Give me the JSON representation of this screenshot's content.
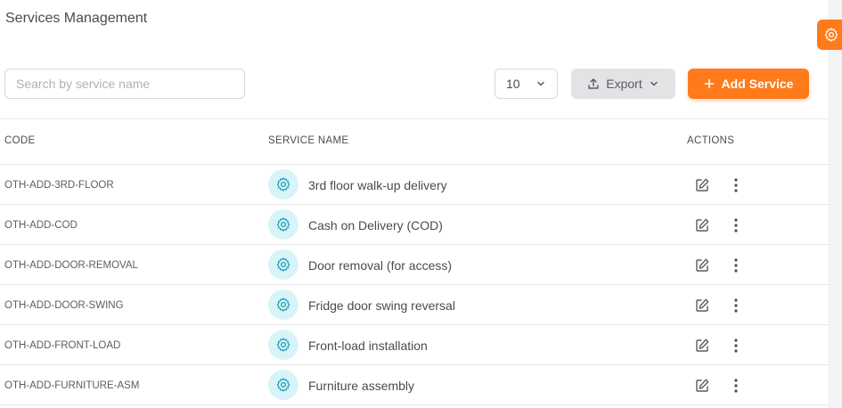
{
  "page": {
    "title": "Services Management"
  },
  "toolbar": {
    "search_placeholder": "Search by service name",
    "search_value": "",
    "page_size": "10",
    "export_label": "Export",
    "add_label": "Add Service"
  },
  "table": {
    "headers": {
      "code": "CODE",
      "service_name": "SERVICE NAME",
      "actions": "ACTIONS"
    },
    "rows": [
      {
        "code": "OTH-ADD-3RD-FLOOR",
        "name": "3rd floor walk-up delivery"
      },
      {
        "code": "OTH-ADD-COD",
        "name": "Cash on Delivery (COD)"
      },
      {
        "code": "OTH-ADD-DOOR-REMOVAL",
        "name": "Door removal (for access)"
      },
      {
        "code": "OTH-ADD-DOOR-SWING",
        "name": "Fridge door swing reversal"
      },
      {
        "code": "OTH-ADD-FRONT-LOAD",
        "name": "Front-load installation"
      },
      {
        "code": "OTH-ADD-FURNITURE-ASM",
        "name": "Furniture assembly"
      }
    ]
  },
  "icons": {
    "settings_fab": "gear-icon",
    "service": "gear-icon",
    "export": "upload-icon",
    "dropdown": "chevron-down-icon",
    "add": "plus-icon",
    "edit": "edit-icon",
    "more": "more-vertical-icon"
  },
  "colors": {
    "accent": "#ff7a1a",
    "service_icon_bg": "#d9f4f8",
    "service_icon_fg": "#17a2b8",
    "export_bg": "#e3e3e6"
  }
}
